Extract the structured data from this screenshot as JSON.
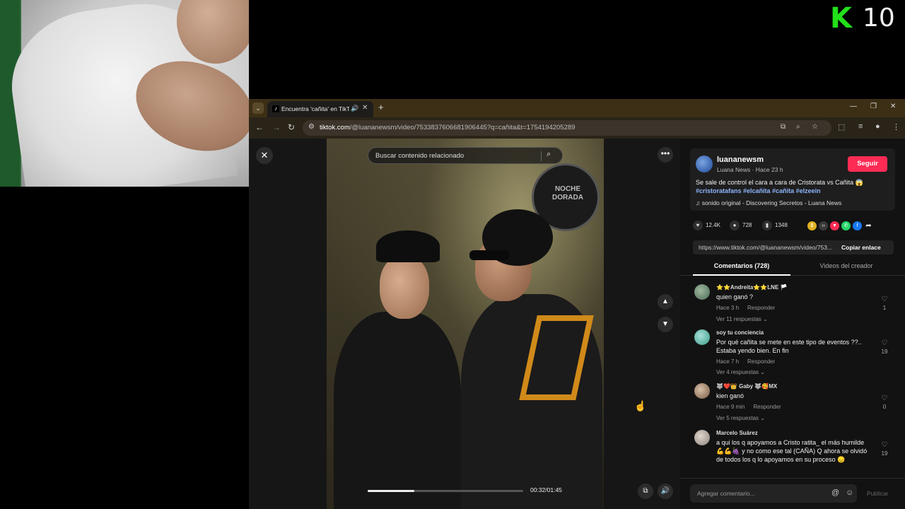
{
  "overlay": {
    "logo_letter": "K",
    "logo_number": "10",
    "logo_color": "#22e01a"
  },
  "browser": {
    "tab_title": "Encuentra 'cañita' en TikTo",
    "url_host": "tiktok.com",
    "url_path": "/@luananewsm/video/7533837606681906445?q=cañita&t=1754194205289"
  },
  "video": {
    "search_placeholder": "Buscar contenido relacionado",
    "badge_text": "NOCHE DORADA",
    "time": "00:32/01:45",
    "progress": 0.3
  },
  "author": {
    "name": "luananewsm",
    "subtitle": "Luana News · Hace 23 h",
    "follow_label": "Seguir",
    "caption": "Se sale de control el cara a cara de Cristorata vs Cañita 😱",
    "tags": "#cristoratafans #elcañita #cañita #elzeein",
    "sound": "♫  sonido original - Discovering Secretos - Luana News"
  },
  "stats": {
    "likes": "12.4K",
    "comments": "728",
    "saves": "1348"
  },
  "share": {
    "link": "https://www.tiktok.com/@luananewsm/video/753...",
    "copy_label": "Copiar enlace"
  },
  "tabs": {
    "comments": "Comentarios (728)",
    "creator": "Videos del creador"
  },
  "comments": [
    {
      "user": "⭐⭐Andreita⭐⭐LNE 🏳️",
      "text": "quien ganó ?",
      "time": "Hace 3 h",
      "reply": "Responder",
      "replies": "Ver 11 respuestas ⌄",
      "likes": "1"
    },
    {
      "user": "soy tu conciencia",
      "text": "Por qué cañita se mete en este tipo de eventos ??.. Estaba yendo bien. En fin",
      "time": "Hace 7 h",
      "reply": "Responder",
      "replies": "Ver 4 respuestas ⌄",
      "likes": "19"
    },
    {
      "user": "🐺❤️👑 Gaby 🐺🥰MX",
      "text": "kien ganó",
      "time": "Hace 9 min",
      "reply": "Responder",
      "replies": "Ver 5 respuestas ⌄",
      "likes": "0"
    },
    {
      "user": "Marcelo Suárez",
      "text": "a qui los q apoyamos a Cristo ratita_ el más humilde 💪💪🍇 y no como ese tal (CAÑA) Q ahora se olvidó de todos los q lo apoyamos en su proceso 😞",
      "likes": "19"
    }
  ],
  "comment_bar": {
    "placeholder": "Agregar comentario...",
    "publish": "Publicar"
  }
}
